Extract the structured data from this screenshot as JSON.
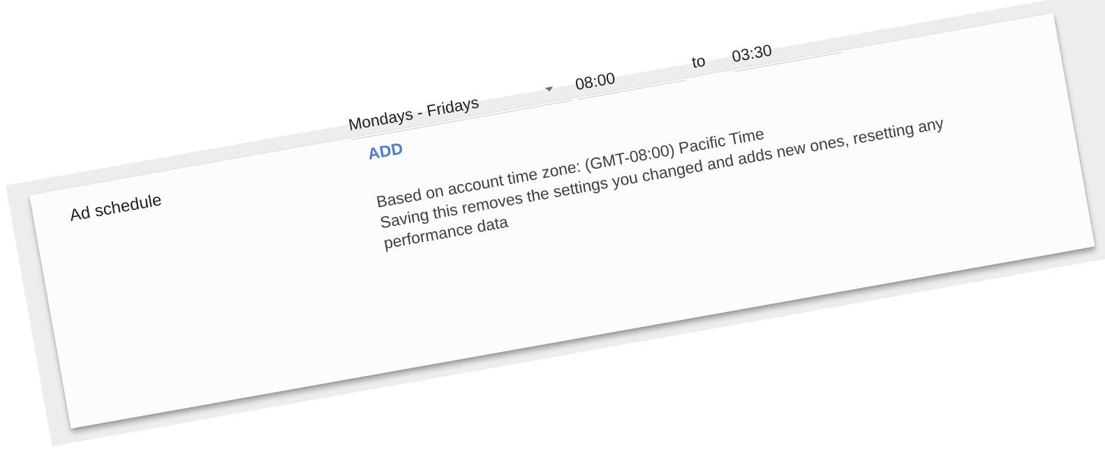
{
  "ad_schedule": {
    "label": "Ad schedule",
    "day_range": "Mondays - Fridays",
    "start_time": "08:00",
    "to_label": "to",
    "end_time": "03:30",
    "add_label": "ADD",
    "timezone_note": "Based on account time zone: (GMT-08:00) Pacific Time",
    "warning_line_1": "Saving this removes the settings you changed and adds new ones, resetting any",
    "warning_line_2": "performance data",
    "icons": {
      "dropdown": "chevron-down-icon"
    },
    "colors": {
      "link": "#4a7bdc",
      "text": "#202124",
      "underline": "#c9c9c9"
    }
  }
}
